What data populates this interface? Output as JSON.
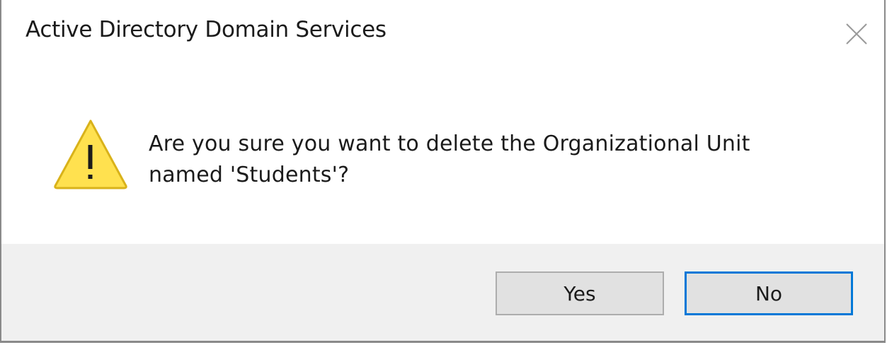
{
  "window": {
    "title": "Active Directory Domain Services",
    "close_icon": "close-icon"
  },
  "message": {
    "icon": "warning-icon",
    "line1": "Are you sure you want to delete the Organizational Unit",
    "line2": "named 'Students'?"
  },
  "buttons": {
    "yes_label": "Yes",
    "no_label": "No",
    "default": "No"
  },
  "colors": {
    "accent_focus": "#0078d7",
    "warning_fill": "#ffe14f",
    "footer_bg": "#f0f0f0"
  }
}
